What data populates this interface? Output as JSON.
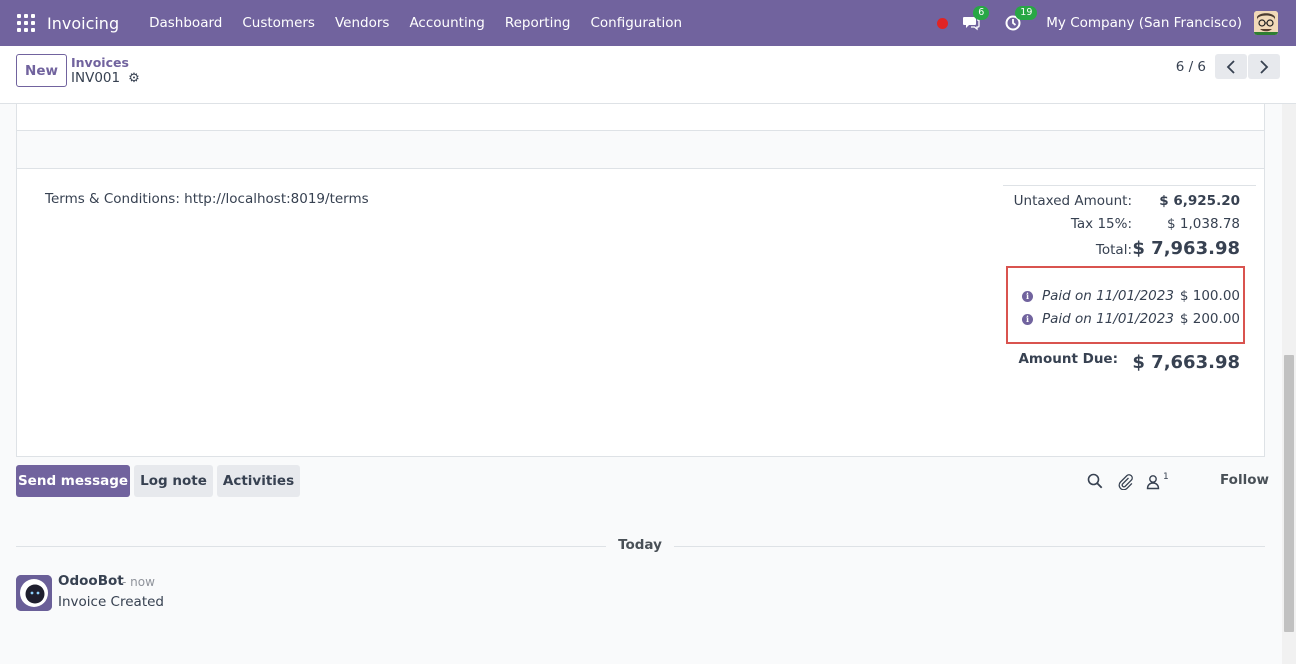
{
  "navbar": {
    "app_name": "Invoicing",
    "menu": [
      "Dashboard",
      "Customers",
      "Vendors",
      "Accounting",
      "Reporting",
      "Configuration"
    ],
    "messages_badge": "6",
    "activities_badge": "19",
    "company": "My Company (San Francisco)",
    "brand_color": "#71639e"
  },
  "control": {
    "new_label": "New",
    "breadcrumb_parent": "Invoices",
    "breadcrumb_current": "INV001",
    "pager": "6 / 6"
  },
  "form": {
    "terms": "Terms & Conditions: http://localhost:8019/terms",
    "totals": {
      "untaxed_label": "Untaxed Amount:",
      "untaxed_value": "$ 6,925.20",
      "tax_label": "Tax 15%:",
      "tax_value": "$ 1,038.78",
      "total_label": "Total:",
      "total_value": "$ 7,963.98",
      "payments": [
        {
          "label": "Paid on 11/01/2023",
          "amount": "$ 100.00"
        },
        {
          "label": "Paid on 11/01/2023",
          "amount": "$ 200.00"
        }
      ],
      "due_label": "Amount Due:",
      "due_value": "$ 7,663.98"
    }
  },
  "chatter": {
    "send_message": "Send message",
    "log_note": "Log note",
    "activities": "Activities",
    "followers_count": "1",
    "follow": "Follow",
    "separator": "Today",
    "message": {
      "author": "OdooBot",
      "time": "- now",
      "body": "Invoice Created"
    }
  }
}
